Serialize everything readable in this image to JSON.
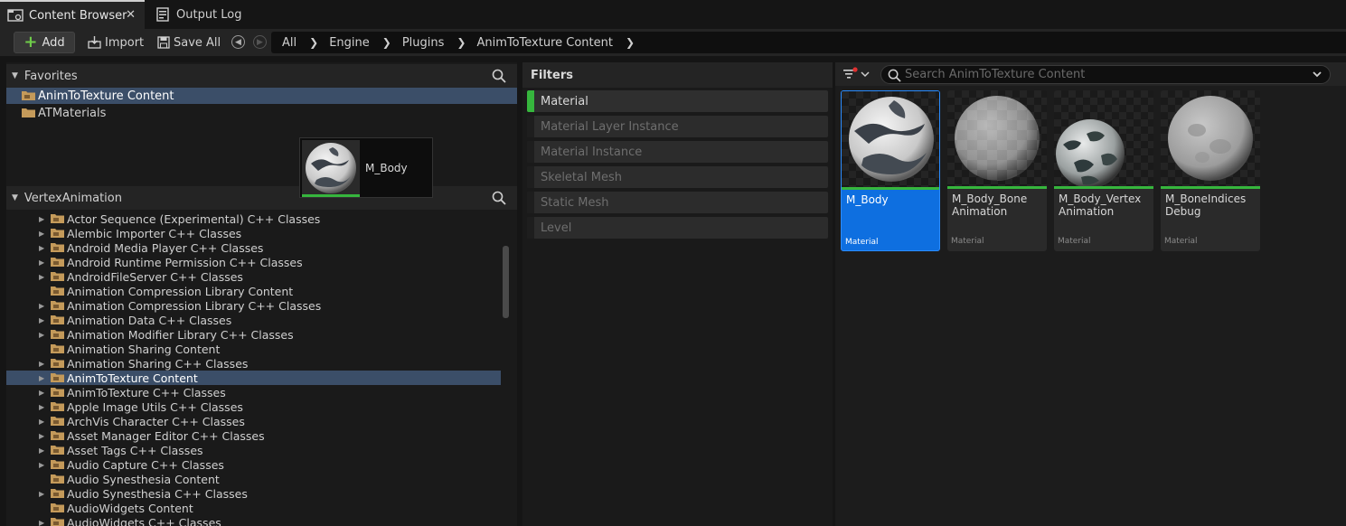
{
  "tabs": [
    {
      "label": "Content Browser",
      "icon": "folder-browser-icon",
      "active": true
    },
    {
      "label": "Output Log",
      "icon": "log-icon",
      "active": false
    }
  ],
  "toolbar": {
    "add_label": "Add",
    "import_label": "Import",
    "save_all_label": "Save All"
  },
  "breadcrumb": [
    "All",
    "Engine",
    "Plugins",
    "AnimToTexture Content"
  ],
  "favorites": {
    "title": "Favorites",
    "items": [
      {
        "label": "AnimToTexture Content",
        "selected": true
      },
      {
        "label": "ATMaterials",
        "selected": false
      }
    ]
  },
  "drag_tooltip": {
    "label": "M_Body"
  },
  "tree": {
    "title": "VertexAnimation",
    "items": [
      {
        "label": "Actor Sequence (Experimental) C++ Classes",
        "expandable": true
      },
      {
        "label": "Alembic Importer C++ Classes",
        "expandable": true
      },
      {
        "label": "Android Media Player C++ Classes",
        "expandable": true
      },
      {
        "label": "Android Runtime Permission C++ Classes",
        "expandable": true
      },
      {
        "label": "AndroidFileServer C++ Classes",
        "expandable": true
      },
      {
        "label": "Animation Compression Library Content",
        "expandable": false
      },
      {
        "label": "Animation Compression Library C++ Classes",
        "expandable": true
      },
      {
        "label": "Animation Data C++ Classes",
        "expandable": true
      },
      {
        "label": "Animation Modifier Library C++ Classes",
        "expandable": true
      },
      {
        "label": "Animation Sharing Content",
        "expandable": false
      },
      {
        "label": "Animation Sharing C++ Classes",
        "expandable": true
      },
      {
        "label": "AnimToTexture Content",
        "expandable": true,
        "selected": true
      },
      {
        "label": "AnimToTexture C++ Classes",
        "expandable": true
      },
      {
        "label": "Apple Image Utils C++ Classes",
        "expandable": true
      },
      {
        "label": "ArchVis Character C++ Classes",
        "expandable": true
      },
      {
        "label": "Asset Manager Editor C++ Classes",
        "expandable": true
      },
      {
        "label": "Asset Tags C++ Classes",
        "expandable": true
      },
      {
        "label": "Audio Capture C++ Classes",
        "expandable": true
      },
      {
        "label": "Audio Synesthesia Content",
        "expandable": false
      },
      {
        "label": "Audio Synesthesia C++ Classes",
        "expandable": true
      },
      {
        "label": "AudioWidgets Content",
        "expandable": false
      },
      {
        "label": "AudioWidgets C++ Classes",
        "expandable": true
      }
    ]
  },
  "filters": {
    "title": "Filters",
    "items": [
      {
        "label": "Material",
        "active": true
      },
      {
        "label": "Material Layer Instance",
        "active": false
      },
      {
        "label": "Material Instance",
        "active": false
      },
      {
        "label": "Skeletal Mesh",
        "active": false
      },
      {
        "label": "Static Mesh",
        "active": false
      },
      {
        "label": "Level",
        "active": false
      }
    ]
  },
  "asset_search": {
    "placeholder": "Search AnimToTexture Content"
  },
  "assets": [
    {
      "name": "M_Body",
      "type": "Material",
      "selected": true,
      "preview": "camo-sphere"
    },
    {
      "name": "M_Body_Bone Animation",
      "type": "Material",
      "selected": false,
      "preview": "checker-sphere"
    },
    {
      "name": "M_Body_Vertex Animation",
      "type": "Material",
      "selected": false,
      "preview": "noise-sphere"
    },
    {
      "name": "M_BoneIndices Debug",
      "type": "Material",
      "selected": false,
      "preview": "grey-sphere"
    }
  ],
  "colors": {
    "accent_green": "#36b63d",
    "selection_blue": "#0e6fe0",
    "tree_selection": "#3b4e68"
  }
}
